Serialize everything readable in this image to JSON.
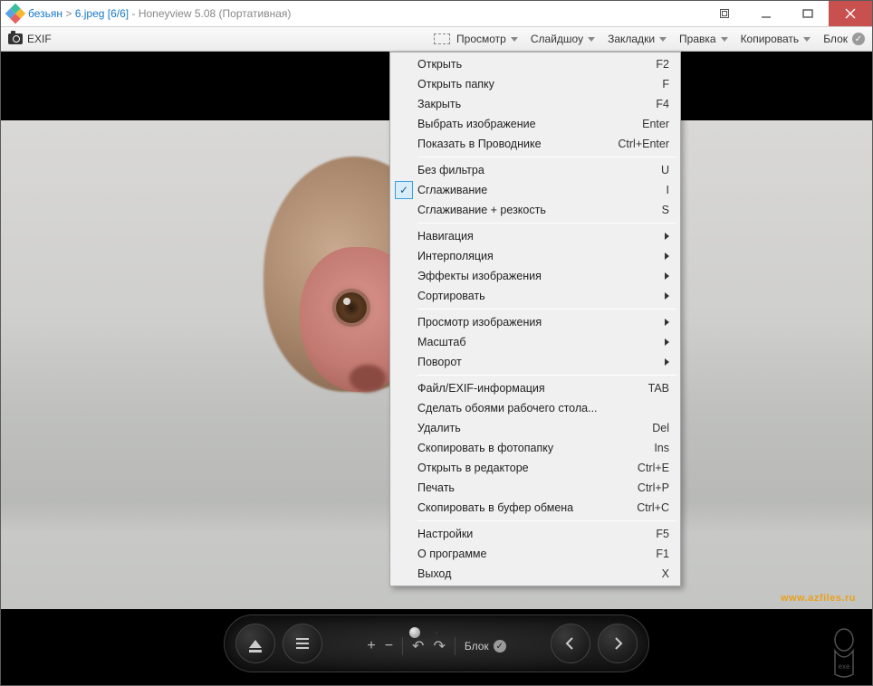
{
  "title": {
    "folder": "безьян",
    "file": "6.jpeg",
    "index": "[6/6]",
    "app": "Honeyview 5.08 (Портативная)"
  },
  "toolbar": {
    "exif": "EXIF",
    "view": "Просмотр",
    "slideshow": "Слайдшоу",
    "bookmarks": "Закладки",
    "edit": "Правка",
    "copy": "Копировать",
    "lock": "Блок"
  },
  "watermark": "www.azfiles.ru",
  "panel": {
    "lock": "Блок"
  },
  "menu": {
    "g1": [
      {
        "label": "Открыть",
        "shortcut": "F2"
      },
      {
        "label": "Открыть папку",
        "shortcut": "F"
      },
      {
        "label": "Закрыть",
        "shortcut": "F4"
      },
      {
        "label": "Выбрать изображение",
        "shortcut": "Enter"
      },
      {
        "label": "Показать в Проводнике",
        "shortcut": "Ctrl+Enter"
      }
    ],
    "g2": [
      {
        "label": "Без фильтра",
        "shortcut": "U",
        "checked": false
      },
      {
        "label": "Сглаживание",
        "shortcut": "I",
        "checked": true
      },
      {
        "label": "Сглаживание + резкость",
        "shortcut": "S",
        "checked": false
      }
    ],
    "g3": [
      {
        "label": "Навигация"
      },
      {
        "label": "Интерполяция"
      },
      {
        "label": "Эффекты изображения"
      },
      {
        "label": "Сортировать"
      }
    ],
    "g4": [
      {
        "label": "Просмотр изображения"
      },
      {
        "label": "Масштаб"
      },
      {
        "label": "Поворот"
      }
    ],
    "g5": [
      {
        "label": "Файл/EXIF-информация",
        "shortcut": "TAB"
      },
      {
        "label": "Сделать обоями рабочего стола...",
        "shortcut": ""
      },
      {
        "label": "Удалить",
        "shortcut": "Del"
      },
      {
        "label": "Скопировать в фотопапку",
        "shortcut": "Ins"
      },
      {
        "label": "Открыть в редакторе",
        "shortcut": "Ctrl+E"
      },
      {
        "label": "Печать",
        "shortcut": "Ctrl+P"
      },
      {
        "label": "Скопировать в буфер обмена",
        "shortcut": "Ctrl+C"
      }
    ],
    "g6": [
      {
        "label": "Настройки",
        "shortcut": "F5"
      },
      {
        "label": "О программе",
        "shortcut": "F1"
      },
      {
        "label": "Выход",
        "shortcut": "X"
      }
    ]
  }
}
